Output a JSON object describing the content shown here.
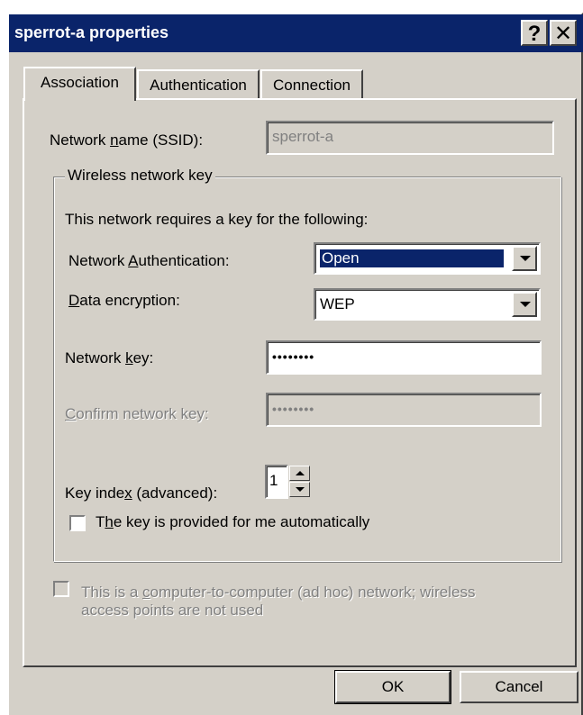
{
  "window": {
    "title": "sperrot-a properties",
    "help_label": "?",
    "close_label": "✕"
  },
  "tabs": [
    {
      "label": "Association",
      "active": true
    },
    {
      "label": "Authentication",
      "active": false
    },
    {
      "label": "Connection",
      "active": false
    }
  ],
  "association": {
    "ssid_label_a": "Network ",
    "ssid_label_u": "n",
    "ssid_label_b": "ame (SSID):",
    "ssid_value": "sperrot-a",
    "group_title": "Wireless network key",
    "requires_text": "This network requires a key for the following:",
    "auth_label_a": "Network ",
    "auth_label_u": "A",
    "auth_label_b": "uthentication:",
    "auth_value": "Open",
    "enc_label_u": "D",
    "enc_label_b": "ata encryption:",
    "enc_value": "WEP",
    "key_label_a": "Network ",
    "key_label_u": "k",
    "key_label_b": "ey:",
    "key_value": "••••••••",
    "confirm_label_u": "C",
    "confirm_label_b": "onfirm network key:",
    "confirm_value": "••••••••",
    "index_label_a": "Key inde",
    "index_label_u": "x",
    "index_label_b": " (advanced):",
    "index_value": "1",
    "auto_label_a": "T",
    "auto_label_u": "h",
    "auto_label_b": "e key is provided for me automatically",
    "adhoc_line1_a": "This is a ",
    "adhoc_line1_u": "c",
    "adhoc_line1_b": "omputer-to-computer (ad hoc) network; wireless",
    "adhoc_line2": "access points are not used"
  },
  "buttons": {
    "ok": "OK",
    "cancel": "Cancel"
  },
  "colors": {
    "title_bar": "#0a246a",
    "face": "#d4d0c8"
  }
}
